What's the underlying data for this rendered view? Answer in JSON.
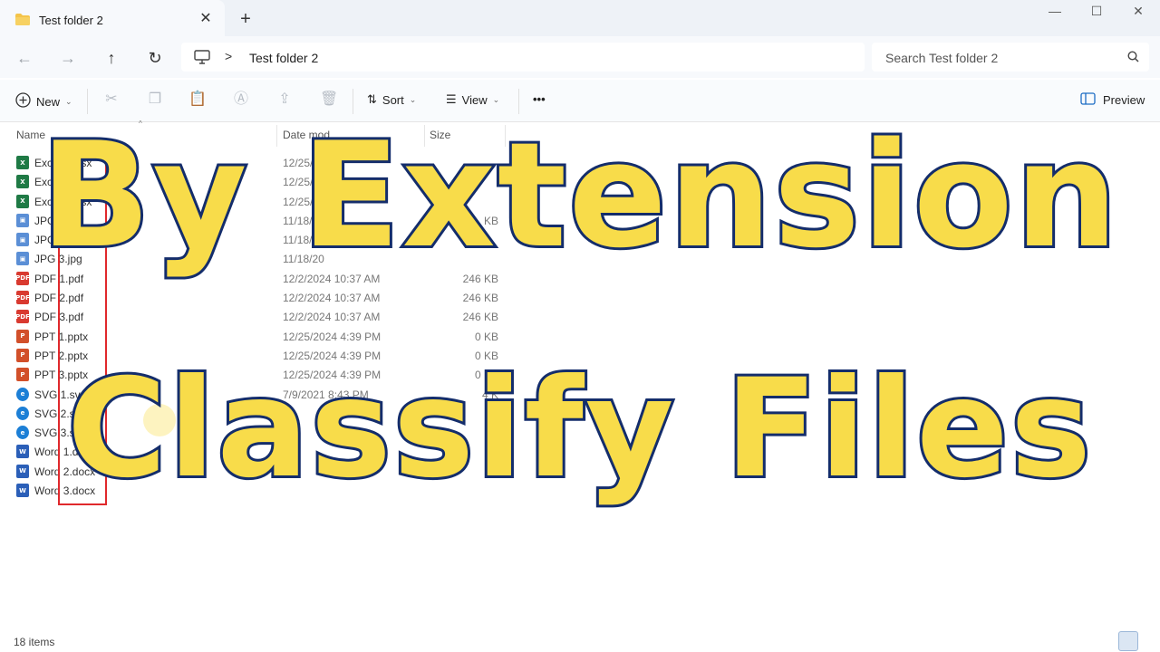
{
  "tab": {
    "title": "Test folder 2"
  },
  "window_controls": [
    "minimize",
    "maximize",
    "close"
  ],
  "address": {
    "crumb": "Test folder 2",
    "separator": ">"
  },
  "search": {
    "placeholder": "Search Test folder 2"
  },
  "toolbar": {
    "new_label": "New",
    "sort_label": "Sort",
    "view_label": "View",
    "more_label": "•••",
    "preview_label": "Preview"
  },
  "columns": {
    "name": "Name",
    "date": "Date mod",
    "size": "Size"
  },
  "files": [
    {
      "name": "Excel 1.xlsx",
      "date": "12/25/20",
      "size": "",
      "type": "excel"
    },
    {
      "name": "Excel 2.xlsx",
      "date": "12/25/20",
      "size": "",
      "type": "excel"
    },
    {
      "name": "Excel 3.xlsx",
      "date": "12/25/20",
      "size": "",
      "type": "excel"
    },
    {
      "name": "JPG 1.jpg",
      "date": "11/18/20",
      "size": "KB",
      "type": "jpg"
    },
    {
      "name": "JPG 2.jpg",
      "date": "11/18/20",
      "size": "",
      "type": "jpg"
    },
    {
      "name": "JPG 3.jpg",
      "date": "11/18/20",
      "size": "",
      "type": "jpg"
    },
    {
      "name": "PDF 1.pdf",
      "date": "12/2/2024 10:37 AM",
      "size": "246 KB",
      "type": "pdf"
    },
    {
      "name": "PDF 2.pdf",
      "date": "12/2/2024 10:37 AM",
      "size": "246 KB",
      "type": "pdf"
    },
    {
      "name": "PDF 3.pdf",
      "date": "12/2/2024 10:37 AM",
      "size": "246 KB",
      "type": "pdf"
    },
    {
      "name": "PPT 1.pptx",
      "date": "12/25/2024 4:39 PM",
      "size": "0 KB",
      "type": "ppt"
    },
    {
      "name": "PPT 2.pptx",
      "date": "12/25/2024 4:39 PM",
      "size": "0 KB",
      "type": "ppt"
    },
    {
      "name": "PPT 3.pptx",
      "date": "12/25/2024 4:39 PM",
      "size": "0 KB",
      "type": "ppt"
    },
    {
      "name": "SVG 1.svg",
      "date": "7/9/2021 8:43 PM",
      "size": "4 K",
      "type": "svg"
    },
    {
      "name": "SVG 2.svg",
      "date": "",
      "size": "",
      "type": "svg"
    },
    {
      "name": "SVG 3.svg",
      "date": "",
      "size": "",
      "type": "svg"
    },
    {
      "name": "Word 1.docx",
      "date": "",
      "size": "",
      "type": "word"
    },
    {
      "name": "Word 2.docx",
      "date": "",
      "size": "",
      "type": "word"
    },
    {
      "name": "Word 3.docx",
      "date": "",
      "size": "",
      "type": "word"
    }
  ],
  "icon_colors": {
    "excel": "#1f7a45",
    "jpg": "#5b8fd6",
    "pdf": "#d93a30",
    "ppt": "#d2502a",
    "svg": "#1c7fd6",
    "word": "#2b5fb8"
  },
  "status": {
    "items": "18 items"
  },
  "overlay": {
    "line1": "By Extension",
    "line2": "Classify Files"
  },
  "colors": {
    "overlay_fill": "#f8dc4a",
    "overlay_stroke": "#142d6b",
    "highlight_box": "#e0282c"
  }
}
